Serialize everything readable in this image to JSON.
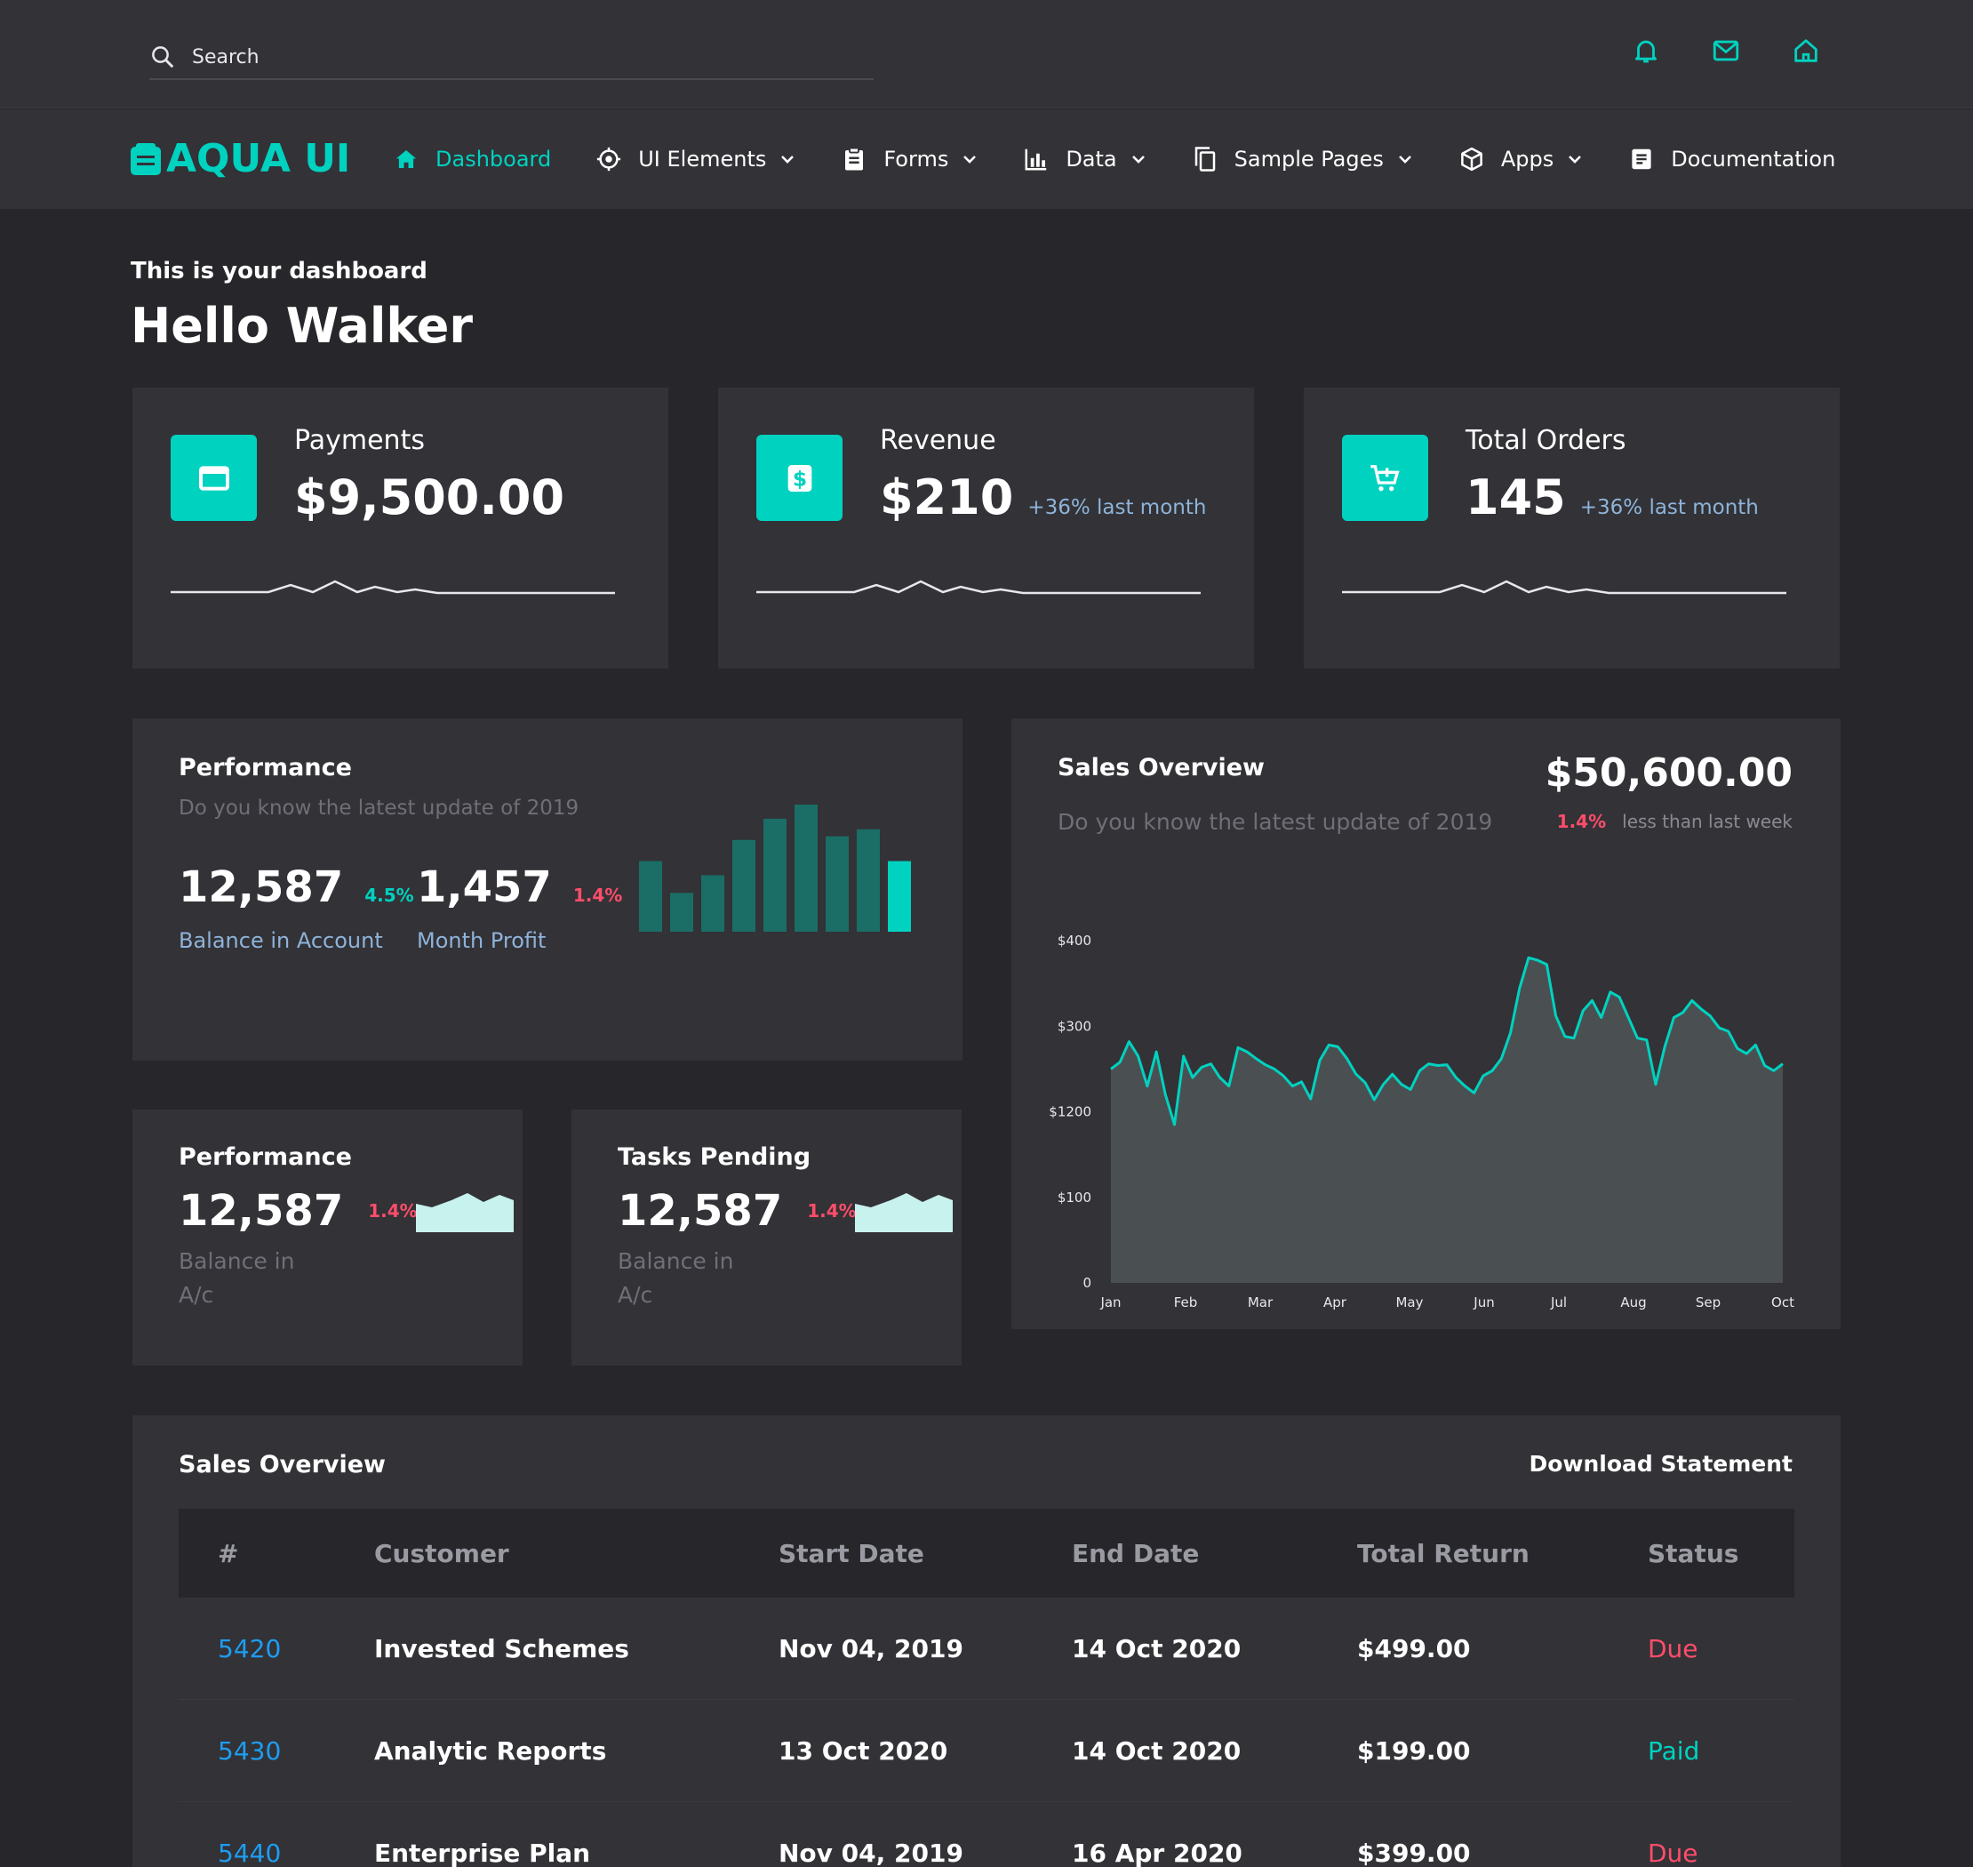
{
  "search": {
    "placeholder": "Search"
  },
  "brand": {
    "name": "AQUA UI"
  },
  "nav": [
    {
      "label": "Dashboard",
      "icon": "home-icon"
    },
    {
      "label": "UI Elements",
      "icon": "crosshair-icon"
    },
    {
      "label": "Forms",
      "icon": "clipboard-icon"
    },
    {
      "label": "Data",
      "icon": "bar-chart-icon"
    },
    {
      "label": "Sample Pages",
      "icon": "copy-icon"
    },
    {
      "label": "Apps",
      "icon": "cube-icon"
    },
    {
      "label": "Documentation",
      "icon": "document-icon"
    }
  ],
  "greeting": {
    "subtitle": "This is your dashboard",
    "title": "Hello Walker"
  },
  "stats": [
    {
      "label": "Payments",
      "value": "$9,500.00",
      "delta": ""
    },
    {
      "label": "Revenue",
      "value": "$210",
      "delta": "+36% last month"
    },
    {
      "label": "Total Orders",
      "value": "145",
      "delta": "+36% last month"
    }
  ],
  "performance": {
    "title": "Performance",
    "subtitle": "Do you know the latest update of 2019",
    "metric1": {
      "value": "12,587",
      "pct": "4.5%",
      "label": "Balance in Account"
    },
    "metric2": {
      "value": "1,457",
      "pct": "1.4%",
      "label": "Month Profit"
    },
    "bars": [
      40,
      22,
      32,
      52,
      64,
      72,
      54,
      58,
      40
    ]
  },
  "small_cards": [
    {
      "title": "Performance",
      "value": "12,587",
      "pct": "1.4%",
      "label": "Balance in A/c"
    },
    {
      "title": "Tasks Pending",
      "value": "12,587",
      "pct": "1.4%",
      "label": "Balance in A/c"
    }
  ],
  "sales_overview": {
    "title": "Sales Overview",
    "subtitle": "Do you know the latest update of 2019",
    "amount": "$50,600.00",
    "delta_pct": "1.4%",
    "delta_text": "less than last week"
  },
  "chart_data": {
    "type": "area",
    "x": [
      "Jan",
      "Feb",
      "Mar",
      "Apr",
      "May",
      "Jun",
      "Jul",
      "Aug",
      "Sep",
      "Oct"
    ],
    "y_ticks": [
      "0",
      "$100",
      "$1200",
      "$300",
      "$400"
    ],
    "ylim": [
      0,
      400
    ],
    "values": [
      250,
      258,
      282,
      265,
      230,
      270,
      220,
      185,
      265,
      240,
      252,
      256,
      240,
      230,
      275,
      270,
      262,
      255,
      250,
      242,
      230,
      235,
      215,
      260,
      278,
      276,
      262,
      244,
      234,
      214,
      232,
      244,
      232,
      226,
      248,
      256,
      254,
      255,
      240,
      230,
      222,
      242,
      248,
      262,
      292,
      344,
      380,
      377,
      372,
      312,
      288,
      286,
      318,
      330,
      310,
      340,
      334,
      310,
      286,
      284,
      232,
      276,
      310,
      316,
      330,
      320,
      312,
      298,
      294,
      274,
      268,
      278,
      254,
      248,
      256
    ]
  },
  "table": {
    "title": "Sales Overview",
    "action": "Download Statement",
    "headers": [
      "#",
      "Customer",
      "Start Date",
      "End Date",
      "Total Return",
      "Status"
    ],
    "rows": [
      {
        "id": "5420",
        "customer": "Invested Schemes",
        "start": "Nov 04, 2019",
        "end": "14 Oct 2020",
        "total": "$499.00",
        "status": "Due"
      },
      {
        "id": "5430",
        "customer": "Analytic Reports",
        "start": "13 Oct 2020",
        "end": "14 Oct 2020",
        "total": "$199.00",
        "status": "Paid"
      },
      {
        "id": "5440",
        "customer": "Enterprise Plan",
        "start": "Nov 04, 2019",
        "end": "16 Apr 2020",
        "total": "$399.00",
        "status": "Due"
      }
    ]
  },
  "colors": {
    "accent": "#00d2c0",
    "danger": "#ff4d6a",
    "link": "#1e9df0",
    "panel": "#323237",
    "background": "#26262b"
  }
}
